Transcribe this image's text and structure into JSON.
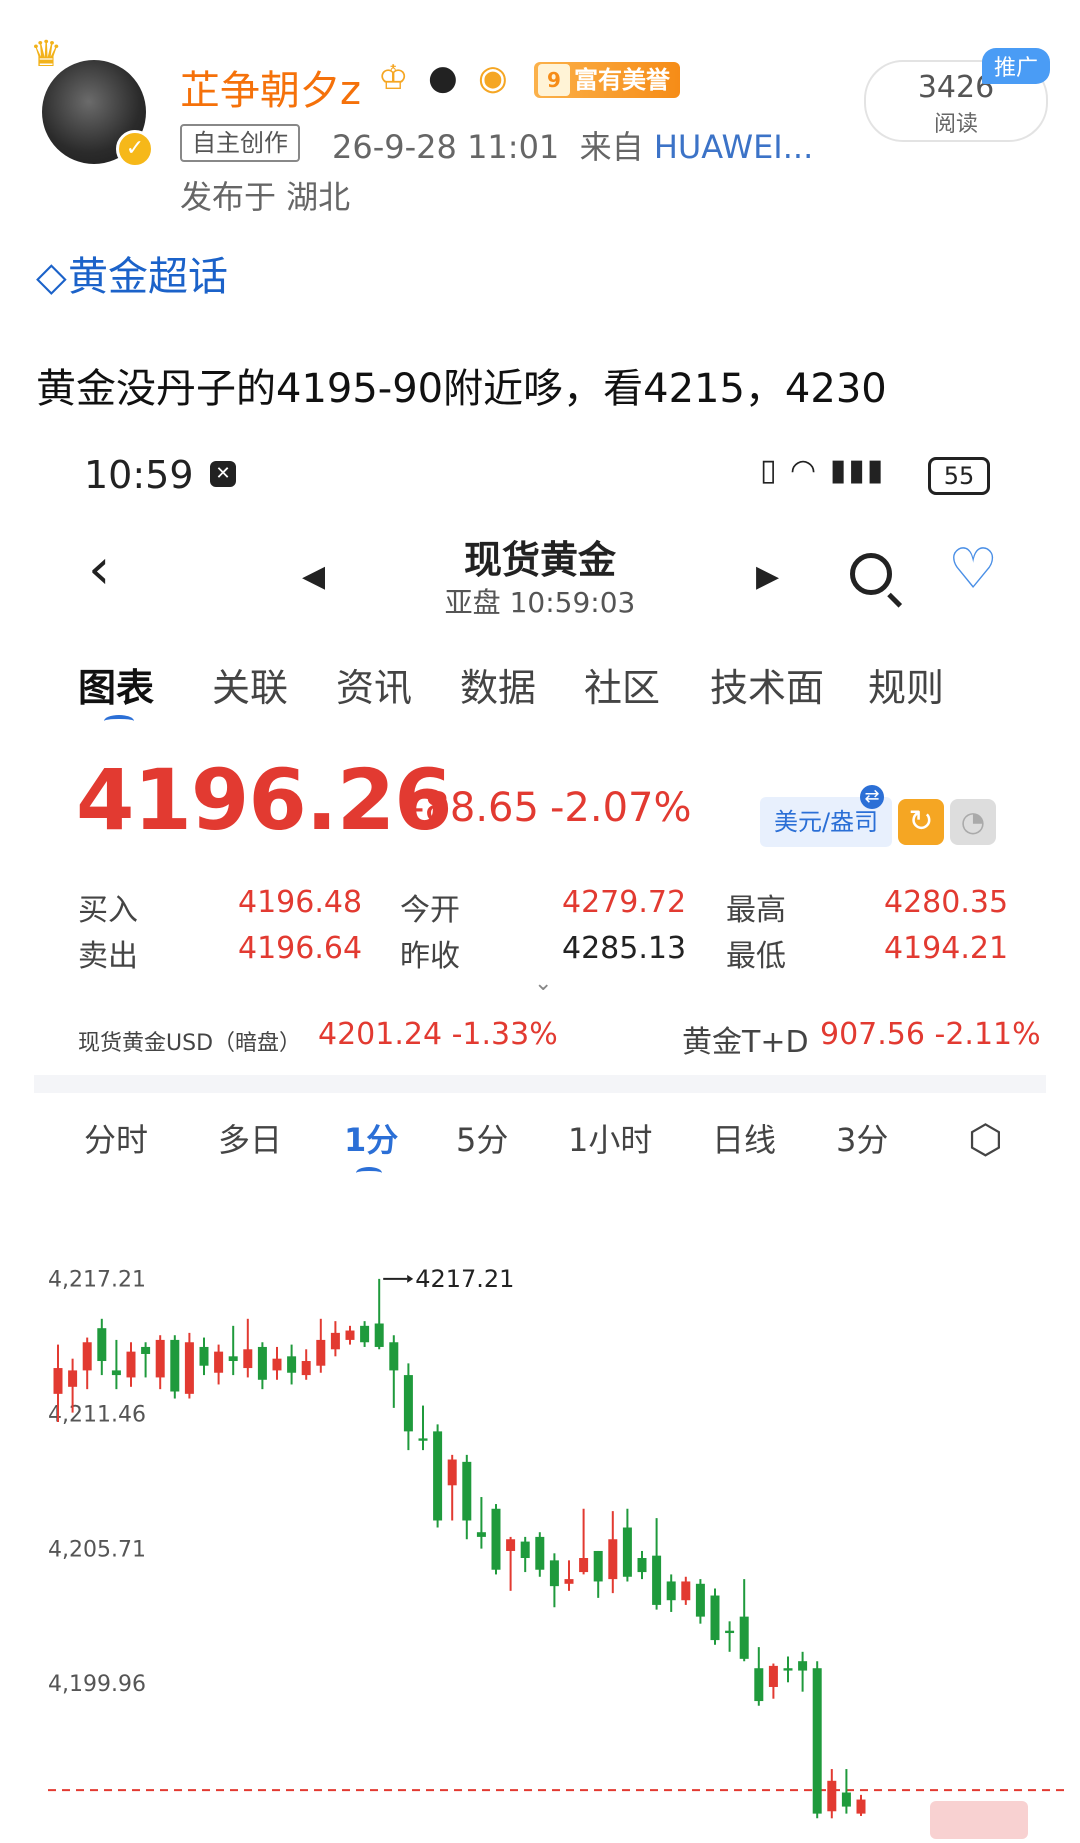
{
  "post": {
    "username": "芷争朝夕z",
    "fame_level": "9",
    "fame_label": "富有美誉",
    "read_count": "3426",
    "read_label": "阅读",
    "promo_label": "推广",
    "source_tag": "自主创作",
    "timestamp": "26-9-28 11:01",
    "from_prefix": "来自",
    "device": "HUAWEI...",
    "location": "发布于 湖北",
    "topic": "黄金超话",
    "text": "黄金没丹子的4195-90附近哆，看4215，4230"
  },
  "app": {
    "status_time": "10:59",
    "battery": "55",
    "title": "现货黄金",
    "subtitle": "亚盘  10:59:03",
    "tabs": [
      "图表",
      "关联",
      "资讯",
      "数据",
      "社区",
      "技术面",
      "规则"
    ],
    "price": "4196.26",
    "change": "-88.65",
    "change_pct": "-2.07%",
    "currency": "美元/盎司",
    "quotes": {
      "buy_label": "买入",
      "buy": "4196.48",
      "sell_label": "卖出",
      "sell": "4196.64",
      "open_label": "今开",
      "open": "4279.72",
      "prev_label": "昨收",
      "prev": "4285.13",
      "high_label": "最高",
      "high": "4280.35",
      "low_label": "最低",
      "low": "4194.21"
    },
    "sub_left_label": "现货黄金USD（暗盘）",
    "sub_left_val": "4201.24 -1.33%",
    "sub_right_label": "黄金T+D",
    "sub_right_val": "907.56 -2.11%",
    "periods": [
      "分时",
      "多日",
      "1分",
      "5分",
      "1小时",
      "日线",
      "3分"
    ],
    "colors": {
      "up": "#e23a31",
      "down": "#1f9a3c",
      "accent": "#2b6fd6"
    }
  },
  "chart_data": {
    "type": "candlestick",
    "interval": "1分",
    "y_ticks": [
      "4,217.21",
      "4,211.46",
      "4,205.71",
      "4,199.96"
    ],
    "ylim": [
      4194.0,
      4219.5
    ],
    "max_marker": "4217.21",
    "ref_line": 4195.4,
    "candles": [
      {
        "o": 4212.3,
        "c": 4213.4,
        "h": 4214.4,
        "l": 4211.1
      },
      {
        "o": 4212.6,
        "c": 4213.3,
        "h": 4213.8,
        "l": 4211.5
      },
      {
        "o": 4213.3,
        "c": 4214.5,
        "h": 4214.7,
        "l": 4212.5
      },
      {
        "o": 4215.1,
        "c": 4213.7,
        "h": 4215.5,
        "l": 4213.1
      },
      {
        "o": 4213.3,
        "c": 4213.1,
        "h": 4214.6,
        "l": 4212.5
      },
      {
        "o": 4213.0,
        "c": 4214.1,
        "h": 4214.5,
        "l": 4212.6
      },
      {
        "o": 4214.3,
        "c": 4214.0,
        "h": 4214.5,
        "l": 4213.0
      },
      {
        "o": 4213.0,
        "c": 4214.6,
        "h": 4214.8,
        "l": 4212.5
      },
      {
        "o": 4214.6,
        "c": 4212.4,
        "h": 4214.8,
        "l": 4212.1
      },
      {
        "o": 4212.3,
        "c": 4214.5,
        "h": 4214.9,
        "l": 4212.1
      },
      {
        "o": 4214.3,
        "c": 4213.5,
        "h": 4214.7,
        "l": 4213.1
      },
      {
        "o": 4213.2,
        "c": 4214.1,
        "h": 4214.4,
        "l": 4212.7
      },
      {
        "o": 4213.9,
        "c": 4213.7,
        "h": 4215.2,
        "l": 4213.1
      },
      {
        "o": 4213.4,
        "c": 4214.2,
        "h": 4215.5,
        "l": 4213.0
      },
      {
        "o": 4214.3,
        "c": 4212.9,
        "h": 4214.5,
        "l": 4212.5
      },
      {
        "o": 4213.3,
        "c": 4213.8,
        "h": 4214.3,
        "l": 4212.9
      },
      {
        "o": 4213.9,
        "c": 4213.2,
        "h": 4214.4,
        "l": 4212.7
      },
      {
        "o": 4213.1,
        "c": 4213.7,
        "h": 4214.2,
        "l": 4212.9
      },
      {
        "o": 4213.5,
        "c": 4214.6,
        "h": 4215.5,
        "l": 4213.2
      },
      {
        "o": 4214.2,
        "c": 4214.9,
        "h": 4215.4,
        "l": 4213.9
      },
      {
        "o": 4214.6,
        "c": 4215.0,
        "h": 4215.2,
        "l": 4214.4
      },
      {
        "o": 4215.2,
        "c": 4214.5,
        "h": 4215.4,
        "l": 4214.3
      },
      {
        "o": 4215.3,
        "c": 4214.3,
        "h": 4217.2,
        "l": 4214.2
      },
      {
        "o": 4214.5,
        "c": 4213.3,
        "h": 4214.8,
        "l": 4211.7
      },
      {
        "o": 4213.1,
        "c": 4210.7,
        "h": 4213.6,
        "l": 4209.9
      },
      {
        "o": 4210.4,
        "c": 4210.3,
        "h": 4211.8,
        "l": 4209.9
      },
      {
        "o": 4210.7,
        "c": 4206.9,
        "h": 4211.0,
        "l": 4206.6
      },
      {
        "o": 4208.4,
        "c": 4209.5,
        "h": 4209.7,
        "l": 4206.9
      },
      {
        "o": 4209.4,
        "c": 4206.9,
        "h": 4209.7,
        "l": 4206.1
      },
      {
        "o": 4206.4,
        "c": 4206.2,
        "h": 4207.9,
        "l": 4205.7
      },
      {
        "o": 4207.4,
        "c": 4204.8,
        "h": 4207.6,
        "l": 4204.6
      },
      {
        "o": 4205.6,
        "c": 4206.1,
        "h": 4206.2,
        "l": 4203.9
      },
      {
        "o": 4206.0,
        "c": 4205.3,
        "h": 4206.2,
        "l": 4204.7
      },
      {
        "o": 4206.2,
        "c": 4204.8,
        "h": 4206.4,
        "l": 4204.5
      },
      {
        "o": 4205.2,
        "c": 4204.1,
        "h": 4205.5,
        "l": 4203.2
      },
      {
        "o": 4204.2,
        "c": 4204.4,
        "h": 4205.2,
        "l": 4203.9
      },
      {
        "o": 4204.7,
        "c": 4205.3,
        "h": 4207.4,
        "l": 4204.6
      },
      {
        "o": 4205.6,
        "c": 4204.3,
        "h": 4205.6,
        "l": 4203.6
      },
      {
        "o": 4204.4,
        "c": 4206.1,
        "h": 4207.3,
        "l": 4203.8
      },
      {
        "o": 4206.6,
        "c": 4204.5,
        "h": 4207.4,
        "l": 4204.3
      },
      {
        "o": 4205.3,
        "c": 4204.7,
        "h": 4205.6,
        "l": 4204.4
      },
      {
        "o": 4205.4,
        "c": 4203.3,
        "h": 4207.0,
        "l": 4203.1
      },
      {
        "o": 4204.3,
        "c": 4203.5,
        "h": 4204.6,
        "l": 4203.0
      },
      {
        "o": 4203.5,
        "c": 4204.3,
        "h": 4204.5,
        "l": 4203.3
      },
      {
        "o": 4204.2,
        "c": 4202.8,
        "h": 4204.4,
        "l": 4202.5
      },
      {
        "o": 4203.7,
        "c": 4201.8,
        "h": 4204.0,
        "l": 4201.6
      },
      {
        "o": 4202.2,
        "c": 4202.1,
        "h": 4202.6,
        "l": 4201.3
      },
      {
        "o": 4202.8,
        "c": 4201.0,
        "h": 4204.4,
        "l": 4200.9
      },
      {
        "o": 4200.6,
        "c": 4199.2,
        "h": 4201.5,
        "l": 4199.0
      },
      {
        "o": 4199.8,
        "c": 4200.7,
        "h": 4200.8,
        "l": 4199.3
      },
      {
        "o": 4200.6,
        "c": 4200.5,
        "h": 4201.1,
        "l": 4200.0
      },
      {
        "o": 4200.9,
        "c": 4200.5,
        "h": 4201.3,
        "l": 4199.6
      },
      {
        "o": 4200.6,
        "c": 4194.4,
        "h": 4200.9,
        "l": 4194.2
      },
      {
        "o": 4194.5,
        "c": 4195.8,
        "h": 4196.3,
        "l": 4194.2
      },
      {
        "o": 4195.3,
        "c": 4194.7,
        "h": 4196.3,
        "l": 4194.4
      },
      {
        "o": 4194.4,
        "c": 4195.0,
        "h": 4195.2,
        "l": 4194.3
      }
    ]
  }
}
